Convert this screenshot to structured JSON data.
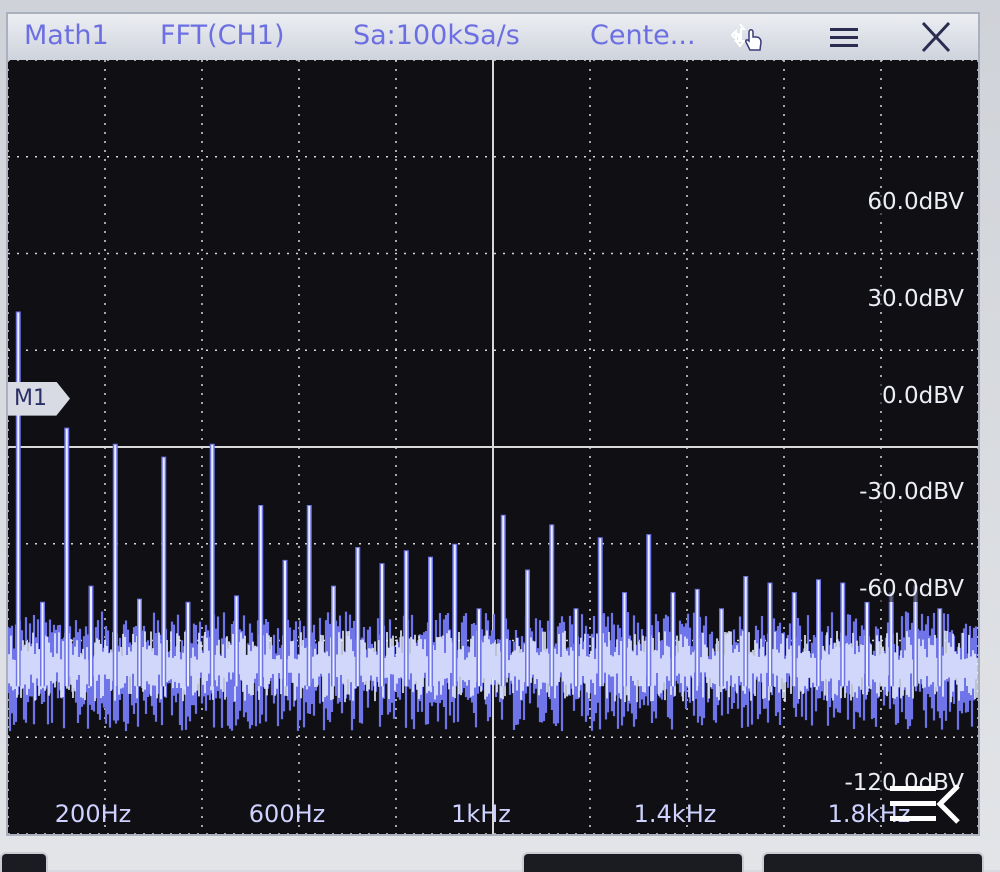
{
  "titlebar": {
    "source_label": "Math1",
    "function_label": "FFT(CH1)",
    "sample_rate_label": "Sa:100kSa/s",
    "center_label": "Cente...",
    "icons": {
      "move": "move-touch-icon",
      "menu": "hamburger-menu-icon",
      "close": "close-icon"
    }
  },
  "marker": {
    "label": "M1",
    "level_dbv": 0
  },
  "y_axis": {
    "unit": "dBV",
    "tick_labels": [
      "60.0dBV",
      "30.0dBV",
      "0.0dBV",
      "-30.0dBV",
      "-60.0dBV",
      "-120.0dBV"
    ],
    "tick_values": [
      60,
      30,
      0,
      -30,
      -60,
      -120
    ],
    "range": [
      -135,
      105
    ]
  },
  "x_axis": {
    "tick_labels": [
      "200Hz",
      "600Hz",
      "1kHz",
      "1.4kHz",
      "1.8kHz"
    ],
    "tick_values": [
      200,
      600,
      1000,
      1400,
      1800
    ],
    "range": [
      0,
      2000
    ]
  },
  "chart_data": {
    "type": "line",
    "x_unit": "Hz",
    "y_unit": "dBV",
    "noise_floor_dbv": -83,
    "harmonic_peaks": {
      "x": [
        50,
        100,
        150,
        200,
        250,
        300,
        350,
        400,
        450,
        500,
        550,
        600,
        650,
        700,
        750,
        800,
        850,
        900,
        950,
        1000,
        1050,
        1100,
        1150,
        1200,
        1250,
        1300,
        1350,
        1400,
        1450,
        1500,
        1550,
        1600,
        1650,
        1700,
        1750,
        1800,
        1850,
        1900,
        1950
      ],
      "y": [
        27,
        -63,
        -9,
        -58,
        -14,
        -62,
        -18,
        -63,
        -14,
        -61,
        -33,
        -50,
        -33,
        -58,
        -46,
        -51,
        -47,
        -49,
        -45,
        -65,
        -36,
        -53,
        -39,
        -65,
        -43,
        -60,
        -42,
        -60,
        -59,
        -65,
        -55,
        -57,
        -60,
        -56,
        -57,
        -63,
        -60,
        -58,
        -65
      ]
    },
    "colors": {
      "trace_core": "#eaf0ff",
      "trace_edge": "#6f74e8",
      "grid": "#d8d8d8",
      "background": "#0f0f14"
    }
  },
  "bottom_panel": {
    "icon": "panel-collapse-icon"
  }
}
